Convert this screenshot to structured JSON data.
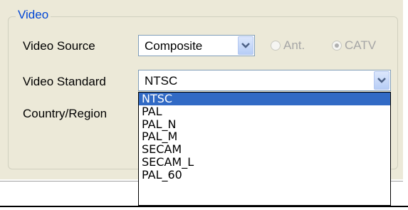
{
  "group": {
    "title": "Video"
  },
  "labels": {
    "video_source": "Video Source",
    "video_standard": "Video Standard",
    "country_region": "Country/Region"
  },
  "video_source_combo": {
    "value": "Composite"
  },
  "radios": [
    {
      "label": "Ant.",
      "checked": false,
      "enabled": false
    },
    {
      "label": "CATV",
      "checked": true,
      "enabled": false
    }
  ],
  "video_standard_combo": {
    "value": "NTSC",
    "expanded": true
  },
  "video_standard_options": [
    "NTSC",
    "PAL",
    "PAL_N",
    "PAL_M",
    "SECAM",
    "SECAM_L",
    "PAL_60"
  ],
  "selected_option": "NTSC",
  "colors": {
    "legend": "#0046d5",
    "selection": "#316ac5",
    "panel": "#ece9d8"
  }
}
